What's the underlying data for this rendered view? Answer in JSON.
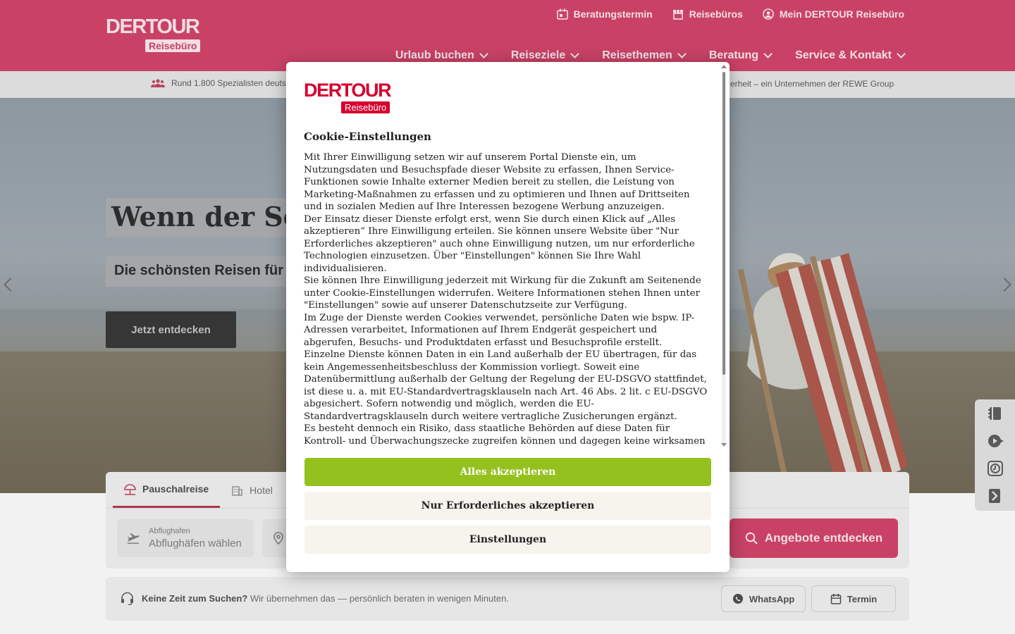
{
  "header": {
    "logo_main": "DERTOUR",
    "logo_sub": "Reisebüro",
    "utility_nav": [
      {
        "label": "Beratungstermin",
        "icon": "calendar-icon"
      },
      {
        "label": "Reisebüros",
        "icon": "store-icon"
      },
      {
        "label": "Mein DERTOUR Reisebüro",
        "icon": "user-circle-icon"
      }
    ],
    "main_nav": [
      {
        "label": "Urlaub buchen"
      },
      {
        "label": "Reiseziele"
      },
      {
        "label": "Reisethemen"
      },
      {
        "label": "Beratung"
      },
      {
        "label": "Service & Kontakt"
      }
    ]
  },
  "trustbar": {
    "left_text": "Rund 1.800 Spezialisten deuts",
    "right_text": "erheit – ein Unternehmen der REWE Group"
  },
  "hero": {
    "title": "Wenn der Sommer",
    "subtitle": "Die schönsten Reisen für Sie",
    "cta_label": "Jetzt entdecken"
  },
  "search": {
    "tabs": [
      {
        "label": "Pauschalreise",
        "icon": "umbrella-plane-icon",
        "active": true
      },
      {
        "label": "Hotel",
        "icon": "hotel-icon",
        "active": false
      }
    ],
    "airport_label": "Abflughafen",
    "airport_value": "Abflughäfen wählen",
    "submit_label": "Angebote entdecken"
  },
  "advice": {
    "bold": "Keine Zeit zum Suchen?",
    "text": " Wir übernehmen das — persönlich beraten in wenigen Minuten.",
    "whatsapp_label": "WhatsApp",
    "termin_label": "Termin"
  },
  "modal": {
    "logo_main": "DERTOUR",
    "logo_sub": "Reisebüro",
    "title": "Cookie-Einstellungen",
    "paragraphs": [
      "Mit Ihrer Einwilligung setzen wir auf unserem Portal Dienste ein, um Nutzungsdaten und Besuchspfade dieser Website zu erfassen, Ihnen Service-Funktionen sowie Inhalte externer Medien bereit zu stellen, die Leistung von Marketing-Maßnahmen zu erfassen und zu optimieren und Ihnen auf Drittseiten und in sozialen Medien auf Ihre Interessen bezogene Werbung anzuzeigen.",
      "Der Einsatz dieser Dienste erfolgt erst, wenn Sie durch einen Klick auf „Alles akzeptieren“ Ihre Einwilligung erteilen. Sie können unsere Website über \"Nur Erforderliches akzeptieren\" auch ohne Einwilligung nutzen, um nur erforderliche Technologien einzusetzen. Über \"Einstellungen\" können Sie Ihre Wahl individualisieren.",
      "Sie können Ihre Einwilligung jederzeit mit Wirkung für die Zukunft am Seitenende unter Cookie-Einstellungen widerrufen. Weitere Informationen stehen Ihnen unter \"Einstellungen\" sowie auf unserer Datenschutzseite zur Verfügung.",
      "Im Zuge der Dienste werden Cookies verwendet, persönliche Daten wie bspw. IP-Adressen verarbeitet, Informationen auf Ihrem Endgerät gespeichert und abgerufen, Besuchs- und Produktdaten erfasst und Besuchsprofile erstellt.",
      "Einzelne Dienste können Daten in ein Land außerhalb der EU übertragen, für das kein Angemessenheitsbeschluss der Kommission vorliegt. Soweit eine Datenübermittlung außerhalb der Geltung der Regelung der EU-DSGVO stattfindet, ist diese u. a. mit EU-Standardvertragsklauseln nach Art. 46 Abs. 2 lit. c EU-DSGVO abgesichert. Sofern notwendig und möglich, werden die EU-Standardvertragsklauseln durch weitere vertragliche Zusicherungen ergänzt.",
      "Es besteht dennoch ein Risiko, dass staatliche Behörden auf diese Daten für Kontroll- und Überwachungszecke zugreifen können und dagegen keine wirksamen"
    ],
    "accept_all_label": "Alles akzeptieren",
    "necessary_label": "Nur Erforderliches akzeptieren",
    "settings_label": "Einstellungen"
  },
  "colors": {
    "brand": "#c94266",
    "modal_brand": "#d6002e",
    "accept": "#95c11f"
  }
}
